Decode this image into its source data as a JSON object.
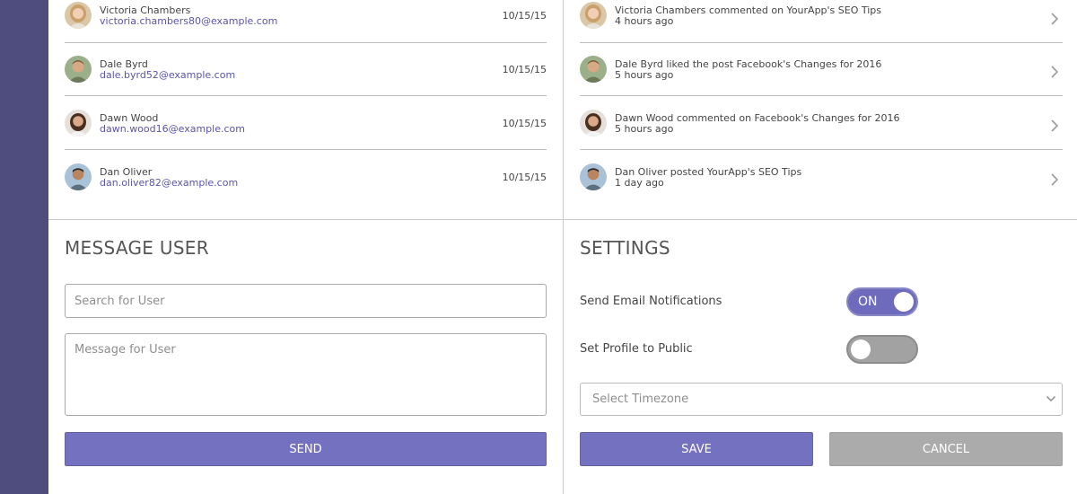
{
  "members": [
    {
      "name": "Victoria Chambers",
      "email": "victoria.chambers80@example.com",
      "date": "10/15/15",
      "avatar": "avatar-victoria"
    },
    {
      "name": "Dale Byrd",
      "email": "dale.byrd52@example.com",
      "date": "10/15/15",
      "avatar": "avatar-dale"
    },
    {
      "name": "Dawn Wood",
      "email": "dawn.wood16@example.com",
      "date": "10/15/15",
      "avatar": "avatar-dawn"
    },
    {
      "name": "Dan Oliver",
      "email": "dan.oliver82@example.com",
      "date": "10/15/15",
      "avatar": "avatar-dan"
    }
  ],
  "activity": [
    {
      "text": "Victoria Chambers commented on YourApp's SEO Tips",
      "time": "4 hours ago",
      "icon": "chevron-right-icon"
    },
    {
      "text": "Dale Byrd liked the post Facebook's Changes for 2016",
      "time": "5 hours ago",
      "icon": "chevron-right-icon"
    },
    {
      "text": "Dawn Wood commented on Facebook's Changes for 2016",
      "time": "5 hours ago",
      "icon": "chevron-right-icon"
    },
    {
      "text": "Dan Oliver posted YourApp's SEO Tips",
      "time": "1 day ago",
      "icon": "chevron-right-icon"
    }
  ],
  "message_user": {
    "title": "MESSAGE USER",
    "search_placeholder": "Search for User",
    "message_placeholder": "Message for User",
    "send_label": "SEND"
  },
  "settings": {
    "title": "SETTINGS",
    "email_notifications_label": "Send Email Notifications",
    "email_notifications_on": true,
    "email_notifications_state_text": "ON",
    "public_profile_label": "Set Profile to Public",
    "public_profile_on": false,
    "timezone_placeholder": "Select Timezone",
    "save_label": "SAVE",
    "cancel_label": "CANCEL"
  },
  "colors": {
    "accent": "#7471c0",
    "sidebar": "#4f4d7e",
    "link": "#5a55a8",
    "cancel": "#ababab"
  }
}
